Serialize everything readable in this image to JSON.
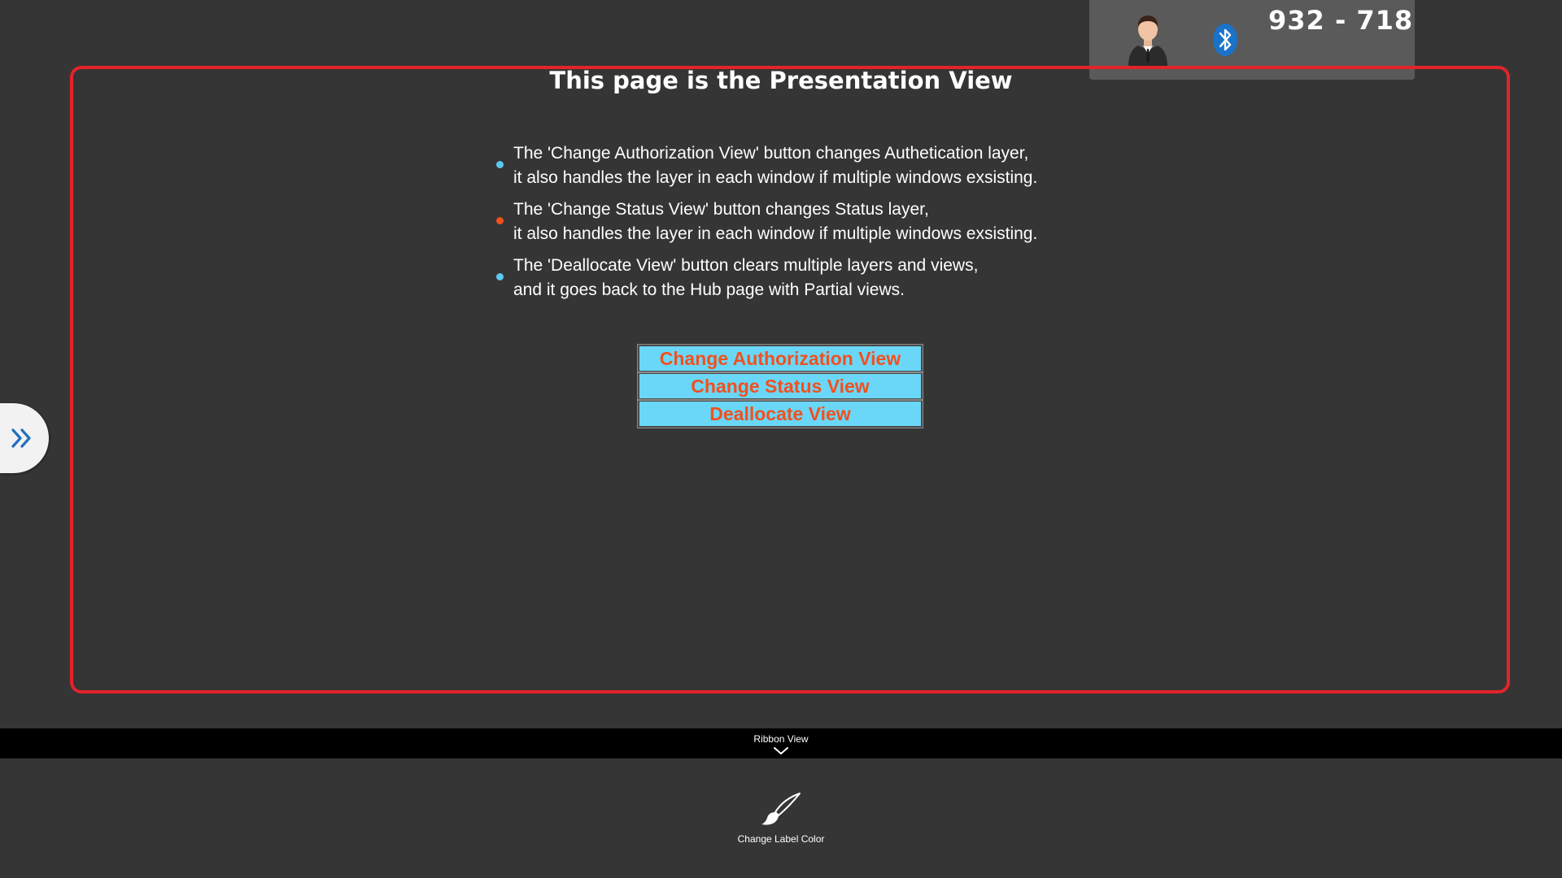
{
  "header": {
    "session_code": "932 - 718",
    "avatar_icon": "user-avatar-icon",
    "bluetooth_icon": "bluetooth-icon"
  },
  "presentation": {
    "title": "This page is the Presentation View",
    "frame_color": "#e3232c",
    "bullets": [
      {
        "line1": "The 'Change Authorization View' button changes Authetication layer,",
        "line2": "it also handles the layer in each window if multiple windows exsisting.",
        "color": "#5bc8f2"
      },
      {
        "line1": "The 'Change Status View' button changes Status layer,",
        "line2": "it also handles the layer in each window if multiple windows exsisting.",
        "color": "#f2501d"
      },
      {
        "line1": "The 'Deallocate View' button clears multiple layers and views,",
        "line2": "and it goes back to the Hub page with Partial views.",
        "color": "#5bc8f2"
      }
    ],
    "buttons": {
      "change_authorization": "Change Authorization View",
      "change_status": "Change Status View",
      "deallocate": "Deallocate View"
    },
    "button_bg": "#6ad7f8",
    "button_text_color": "#f2501d"
  },
  "side_toggle": {
    "icon": "double-chevron-right-icon"
  },
  "ribbon": {
    "title": "Ribbon View",
    "chevron_icon": "chevron-down-icon",
    "commands": [
      {
        "label": "Change Label Color",
        "icon": "brush-icon"
      }
    ]
  }
}
